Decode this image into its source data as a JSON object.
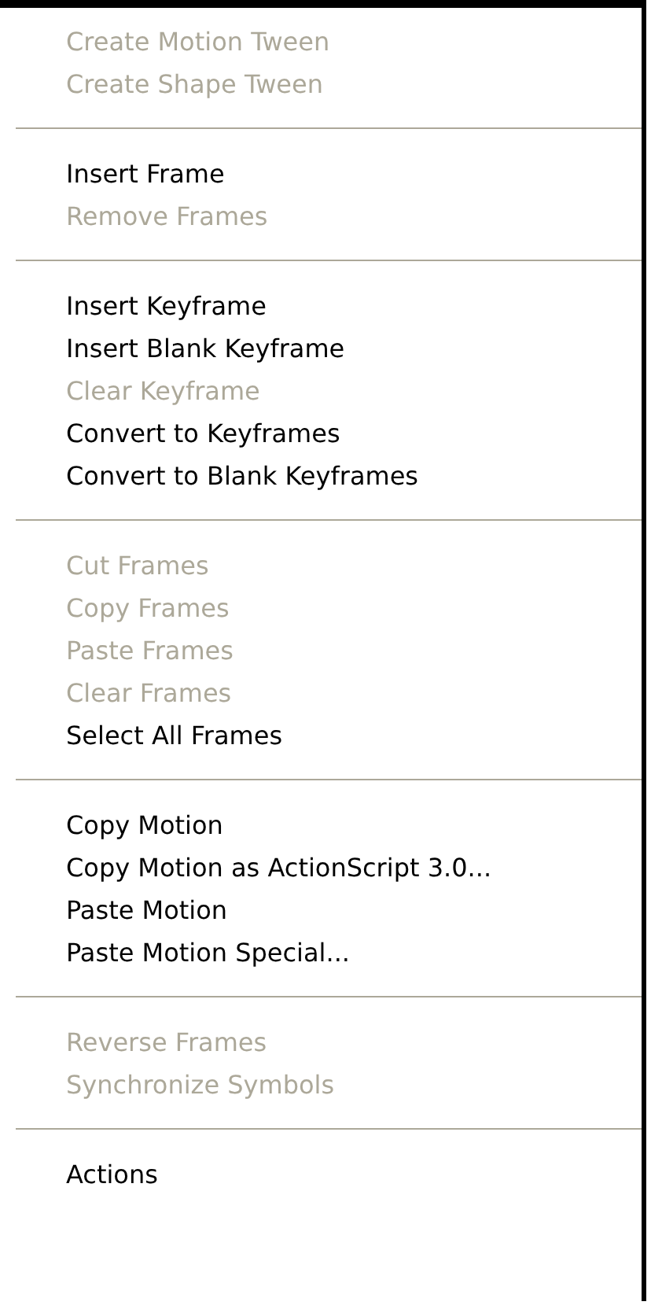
{
  "menu": {
    "groups": [
      {
        "items": [
          {
            "label": "Create Motion Tween",
            "disabled": true
          },
          {
            "label": "Create Shape Tween",
            "disabled": true
          }
        ]
      },
      {
        "items": [
          {
            "label": "Insert Frame",
            "disabled": false
          },
          {
            "label": "Remove Frames",
            "disabled": true
          }
        ]
      },
      {
        "items": [
          {
            "label": "Insert Keyframe",
            "disabled": false
          },
          {
            "label": "Insert Blank Keyframe",
            "disabled": false
          },
          {
            "label": "Clear Keyframe",
            "disabled": true
          },
          {
            "label": "Convert to Keyframes",
            "disabled": false
          },
          {
            "label": "Convert to Blank Keyframes",
            "disabled": false
          }
        ]
      },
      {
        "items": [
          {
            "label": "Cut Frames",
            "disabled": true
          },
          {
            "label": "Copy Frames",
            "disabled": true
          },
          {
            "label": "Paste Frames",
            "disabled": true
          },
          {
            "label": "Clear Frames",
            "disabled": true
          },
          {
            "label": "Select All Frames",
            "disabled": false
          }
        ]
      },
      {
        "items": [
          {
            "label": "Copy Motion",
            "disabled": false
          },
          {
            "label": "Copy Motion as ActionScript 3.0...",
            "disabled": false
          },
          {
            "label": "Paste Motion",
            "disabled": false
          },
          {
            "label": "Paste Motion Special...",
            "disabled": false
          }
        ]
      },
      {
        "items": [
          {
            "label": "Reverse Frames",
            "disabled": true
          },
          {
            "label": "Synchronize Symbols",
            "disabled": true
          }
        ]
      },
      {
        "items": [
          {
            "label": "Actions",
            "disabled": false
          }
        ]
      }
    ]
  }
}
